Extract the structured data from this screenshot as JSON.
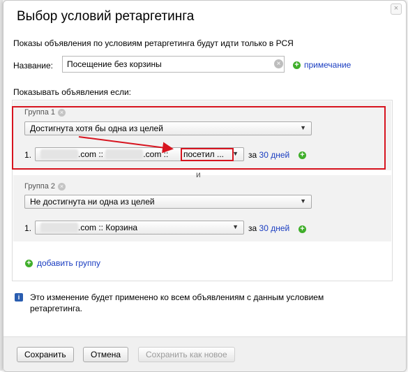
{
  "dialog": {
    "title": "Выбор условий ретаргетинга",
    "close_glyph": "×",
    "info_text": "Показы объявления по условиям ретаргетинга будут идти только в РСЯ"
  },
  "name_field": {
    "label": "Название:",
    "value": "Посещение без корзины",
    "clear_glyph": "×",
    "note_link": "примечание"
  },
  "show_if_label": "Показывать объявления если:",
  "groups": [
    {
      "title": "Группа 1",
      "remove_glyph": "×",
      "condition_type": "Достигнута хотя бы одна из целей",
      "rows": [
        {
          "number": "1.",
          "goal_prefix": ".com :: ",
          "goal_middle": ".com ::",
          "goal_highlight": "посетил ...",
          "za": "за",
          "days": "30 дней"
        }
      ]
    },
    {
      "title": "Группа 2",
      "remove_glyph": "×",
      "condition_type": "Не достигнута ни одна из целей",
      "rows": [
        {
          "number": "1.",
          "goal_prefix": ".com :: Корзина",
          "za": "за",
          "days": "30 дней"
        }
      ]
    }
  ],
  "and_label": "и",
  "add_group": "добавить группу",
  "notice": "Это изменение будет применено ко всем объявлениям с данным условием ретаргетинга.",
  "footer": {
    "save": "Сохранить",
    "cancel": "Отмена",
    "save_as_new": "Сохранить как новое"
  },
  "colors": {
    "link": "#1a3dc1",
    "annotation_red": "#d7141f",
    "plus_green": "#3fae2a"
  }
}
